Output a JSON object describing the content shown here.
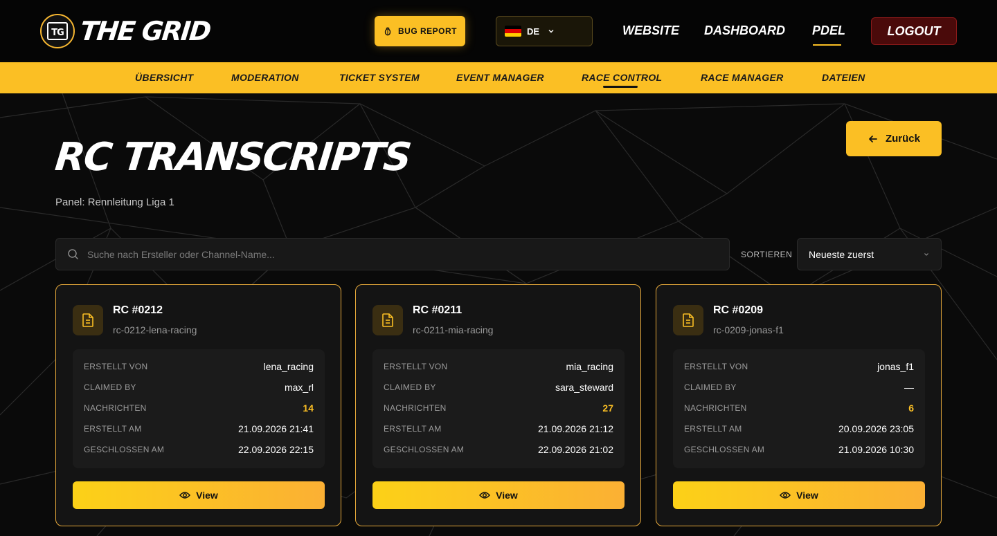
{
  "brand": {
    "logo_badge": "TG",
    "logo_text": "THE GRID",
    "accent": "#fbbf24"
  },
  "header": {
    "bug_report_label": "BUG REPORT",
    "language_label": "DE",
    "nav": [
      "WEBSITE",
      "DASHBOARD",
      "PDEL"
    ],
    "logout_label": "LOGOUT"
  },
  "subnav": {
    "items": [
      "ÜBERSICHT",
      "MODERATION",
      "TICKET SYSTEM",
      "EVENT MANAGER",
      "RACE CONTROL",
      "RACE MANAGER",
      "DATEIEN"
    ],
    "active": "RACE CONTROL"
  },
  "page": {
    "title": "RC TRANSCRIPTS",
    "panel_label": "Panel: Rennleitung Liga 1",
    "back_label": "Zurück"
  },
  "search": {
    "placeholder": "Suche nach Ersteller oder Channel-Name...",
    "value": ""
  },
  "sort": {
    "label": "SORTIEREN",
    "selected": "Neueste zuerst"
  },
  "card_labels": {
    "created_by": "ERSTELLT VON",
    "claimed_by": "CLAIMED BY",
    "messages": "NACHRICHTEN",
    "created_at": "ERSTELLT AM",
    "closed_at": "GESCHLOSSEN AM",
    "view": "View"
  },
  "cards": [
    {
      "title": "RC #0212",
      "channel": "rc-0212-lena-racing",
      "created_by": "lena_racing",
      "claimed_by": "max_rl",
      "messages": "14",
      "created_at": "21.09.2026 21:41",
      "closed_at": "22.09.2026 22:15"
    },
    {
      "title": "RC #0211",
      "channel": "rc-0211-mia-racing",
      "created_by": "mia_racing",
      "claimed_by": "sara_steward",
      "messages": "27",
      "created_at": "21.09.2026 21:12",
      "closed_at": "22.09.2026 21:02"
    },
    {
      "title": "RC #0209",
      "channel": "rc-0209-jonas-f1",
      "created_by": "jonas_f1",
      "claimed_by": "—",
      "messages": "6",
      "created_at": "20.09.2026 23:05",
      "closed_at": "21.09.2026 10:30"
    }
  ]
}
